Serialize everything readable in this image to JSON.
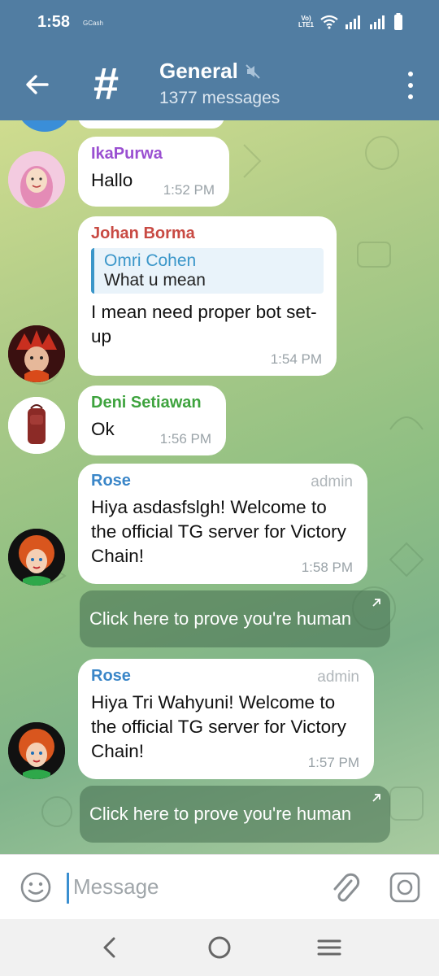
{
  "status_bar": {
    "time": "1:58",
    "app_indicator": "GCash",
    "volte_top": "Vo)",
    "volte_bottom": "LTE1"
  },
  "header": {
    "title": "General",
    "subtitle": "1377 messages",
    "icons": [
      "back-arrow-icon",
      "hash-icon",
      "muted-icon",
      "more-vert-icon"
    ]
  },
  "messages": [
    {
      "sender": "IkaPurwa",
      "text": "Hallo",
      "time": "1:52 PM",
      "name_color": "#9a4fd1"
    },
    {
      "sender": "Johan Borma",
      "reply_to": {
        "name": "Omri Cohen",
        "text": "What u mean"
      },
      "text": "I mean need proper bot set-up",
      "time": "1:54 PM",
      "name_color": "#c84a43"
    },
    {
      "sender": "Deni Setiawan",
      "text": "Ok",
      "time": "1:56 PM",
      "name_color": "#3ea33e"
    },
    {
      "sender": "Rose",
      "badge": "admin",
      "text": "Hiya asdasfslgh! Welcome to the official TG server for Victory Chain!",
      "time": "1:58 PM",
      "name_color": "#3a86c8",
      "button": "Click here to prove you're human"
    },
    {
      "sender": "Rose",
      "badge": "admin",
      "text": "Hiya Tri Wahyuni! Welcome to the official TG server for Victory Chain!",
      "time": "1:57 PM",
      "name_color": "#3a86c8",
      "button": "Click here to prove you're human"
    }
  ],
  "input": {
    "placeholder": "Message",
    "icons": [
      "emoji-icon",
      "attach-icon",
      "camera-icon"
    ]
  },
  "colors": {
    "header_bg": "#517DA2",
    "accent": "#3a96c9"
  }
}
